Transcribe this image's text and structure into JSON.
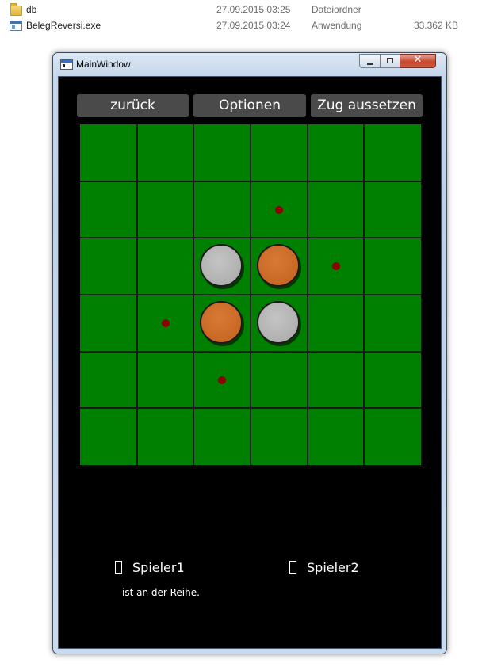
{
  "explorer": {
    "files": [
      {
        "icon": "folder-icon",
        "name": "db",
        "date": "27.09.2015 03:25",
        "type": "Dateiordner",
        "size": ""
      },
      {
        "icon": "exe-icon",
        "name": "BelegReversi.exe",
        "date": "27.09.2015 03:24",
        "type": "Anwendung",
        "size": "33.362 KB"
      }
    ]
  },
  "window": {
    "title": "MainWindow",
    "close_glyph": "✕"
  },
  "toolbar": {
    "back_label": "zurück",
    "options_label": "Optionen",
    "skip_label": "Zug aussetzen"
  },
  "board": {
    "rows": 6,
    "cols": 6,
    "colors": {
      "board": "#008000",
      "white": "#b5b5b5",
      "orange": "#cc6a28",
      "hint": "#8b0000"
    },
    "pieces": [
      {
        "row": 2,
        "col": 2,
        "color": "white"
      },
      {
        "row": 2,
        "col": 3,
        "color": "orange"
      },
      {
        "row": 3,
        "col": 2,
        "color": "orange"
      },
      {
        "row": 3,
        "col": 3,
        "color": "white"
      }
    ],
    "valid_moves": [
      {
        "row": 1,
        "col": 3
      },
      {
        "row": 2,
        "col": 4
      },
      {
        "row": 3,
        "col": 1
      },
      {
        "row": 4,
        "col": 2
      }
    ]
  },
  "players": {
    "player1": "Spieler1",
    "player2": "Spieler2",
    "turn_text": "ist an der Reihe."
  }
}
